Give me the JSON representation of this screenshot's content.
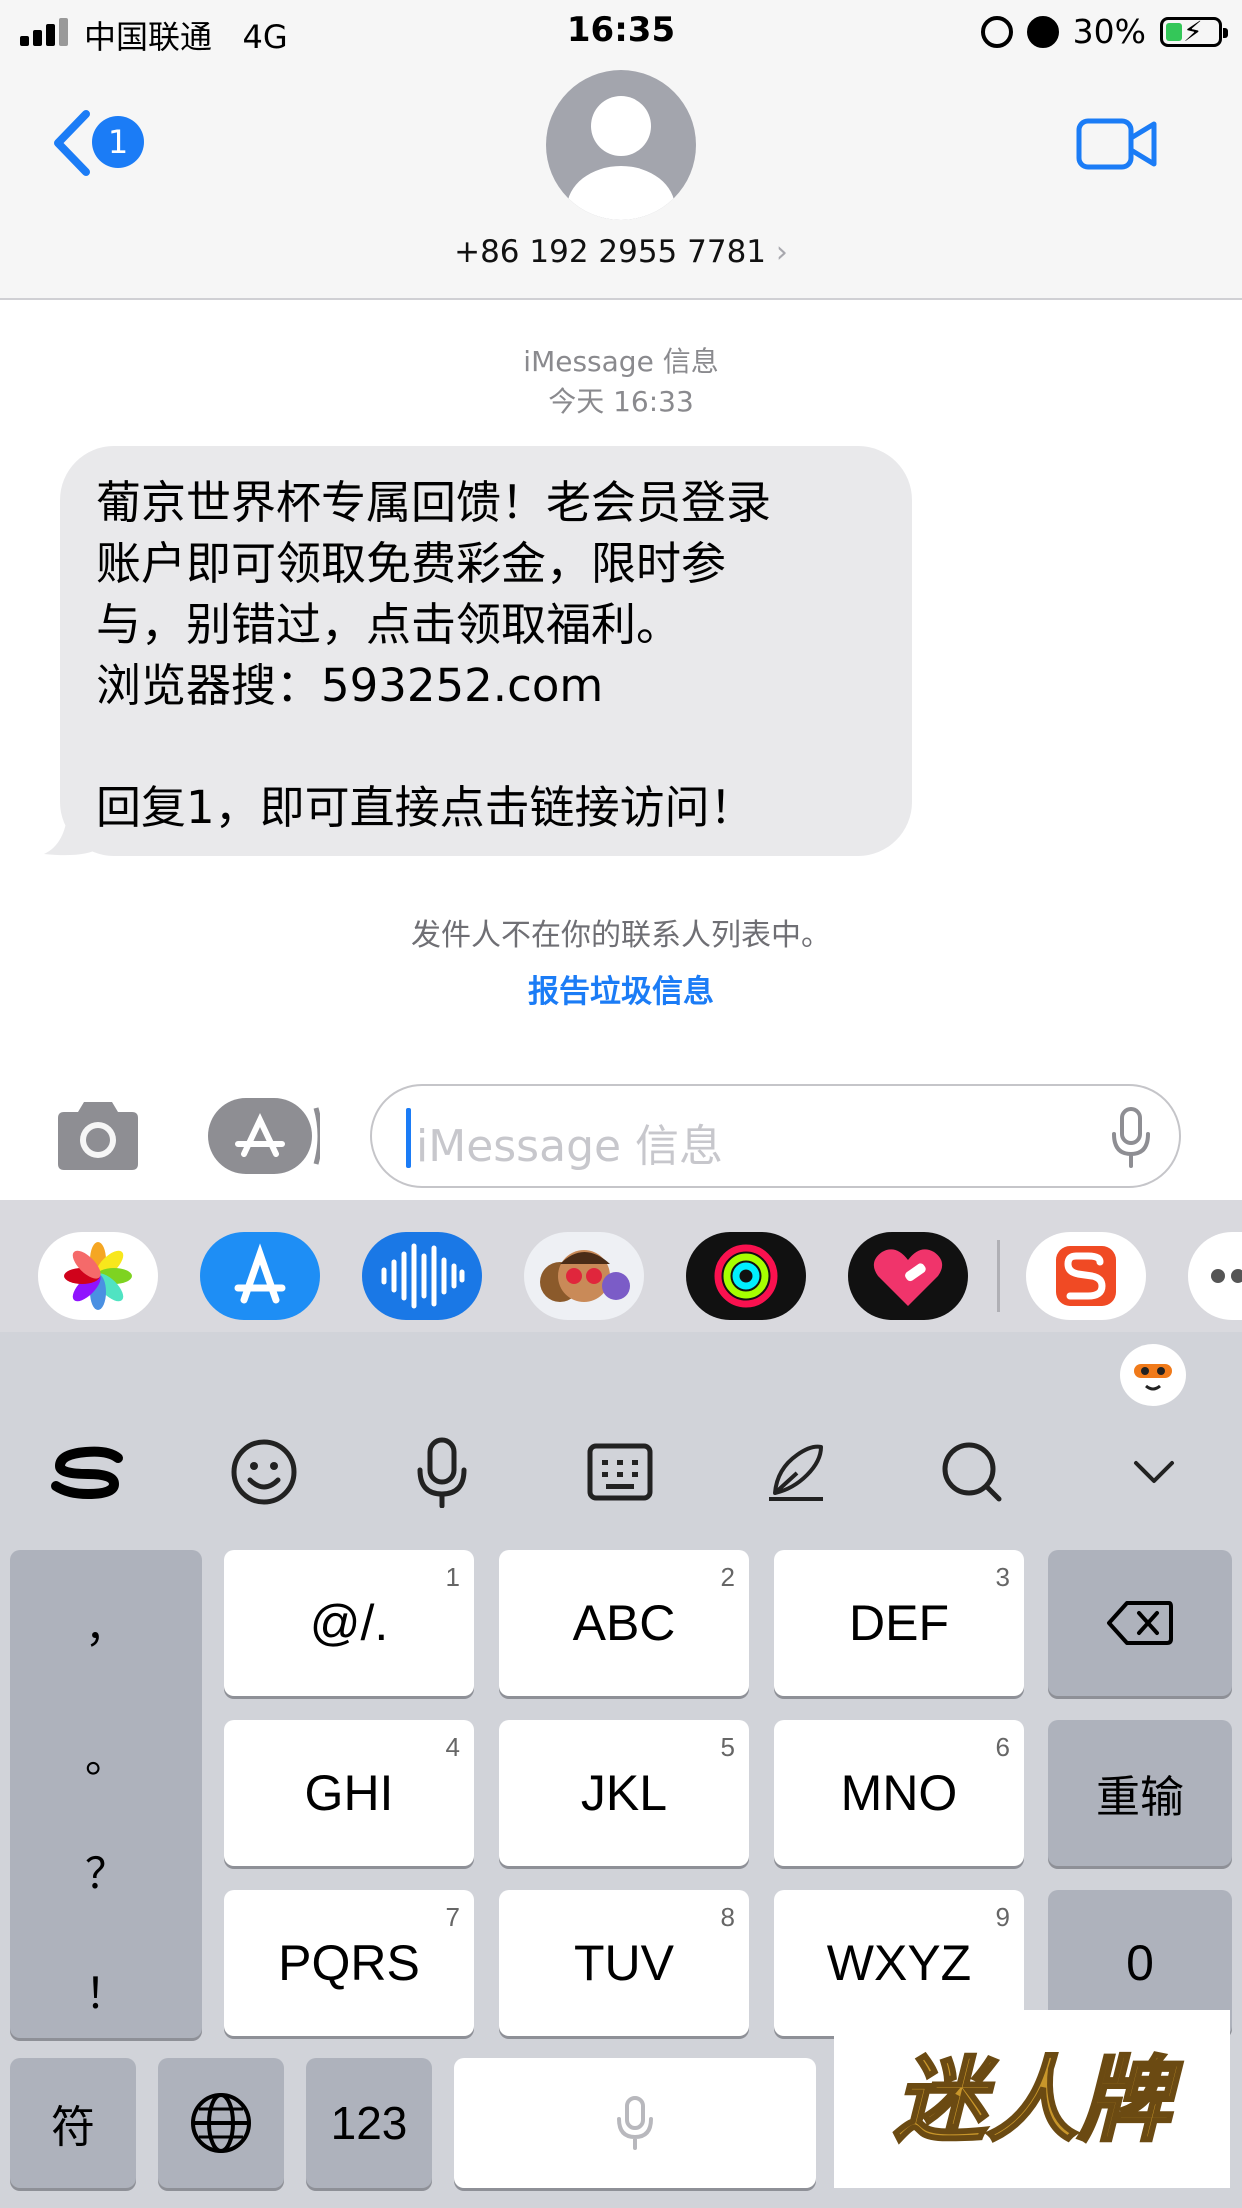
{
  "status_bar": {
    "carrier": "中国联通",
    "network": "4G",
    "time": "16:35",
    "battery": "30%"
  },
  "header": {
    "back_badge": "1",
    "contact": "+86 192 2955 7781",
    "chevron": "›"
  },
  "conversation": {
    "service": "iMessage 信息",
    "timestamp": "今天 16:33",
    "message": "葡京世界杯专属回馈！老会员登录\n账户即可领取免费彩金，限时参\n与，别错过，点击领取福利。\n浏览器搜：593252.com\n\n回复1，即可直接点击链接访问！",
    "unknown_sender": "发件人不在你的联系人列表中。",
    "report_link": "报告垃圾信息"
  },
  "input": {
    "placeholder": "iMessage 信息"
  },
  "app_drawer": {
    "apps": [
      "photos-icon",
      "app-store-icon",
      "audio-icon",
      "memoji-icon",
      "activity-icon",
      "heart-app-icon",
      "sogou-icon",
      "more-icon"
    ]
  },
  "keyboard": {
    "toolbar": [
      "sogou-logo-icon",
      "emoji-icon",
      "voice-icon",
      "keyboard-icon",
      "handwriting-icon",
      "search-icon",
      "collapse-icon"
    ],
    "punctuation": [
      "，",
      "。",
      "？",
      "！"
    ],
    "keys": [
      {
        "label": "@/.",
        "num": "1"
      },
      {
        "label": "ABC",
        "num": "2"
      },
      {
        "label": "DEF",
        "num": "3"
      },
      {
        "label": "GHI",
        "num": "4"
      },
      {
        "label": "JKL",
        "num": "5"
      },
      {
        "label": "MNO",
        "num": "6"
      },
      {
        "label": "PQRS",
        "num": "7"
      },
      {
        "label": "TUV",
        "num": "8"
      },
      {
        "label": "WXYZ",
        "num": "9"
      }
    ],
    "reenter": "重输",
    "zero": "0",
    "symbols": "符",
    "numbers": "123"
  },
  "watermark": {
    "text": "迷人牌"
  },
  "colors": {
    "accent": "#1b7cf6",
    "bubble": "#e9e9eb",
    "keyboard_bg": "#d1d3d9",
    "watermark_gold": "#c8962a"
  }
}
